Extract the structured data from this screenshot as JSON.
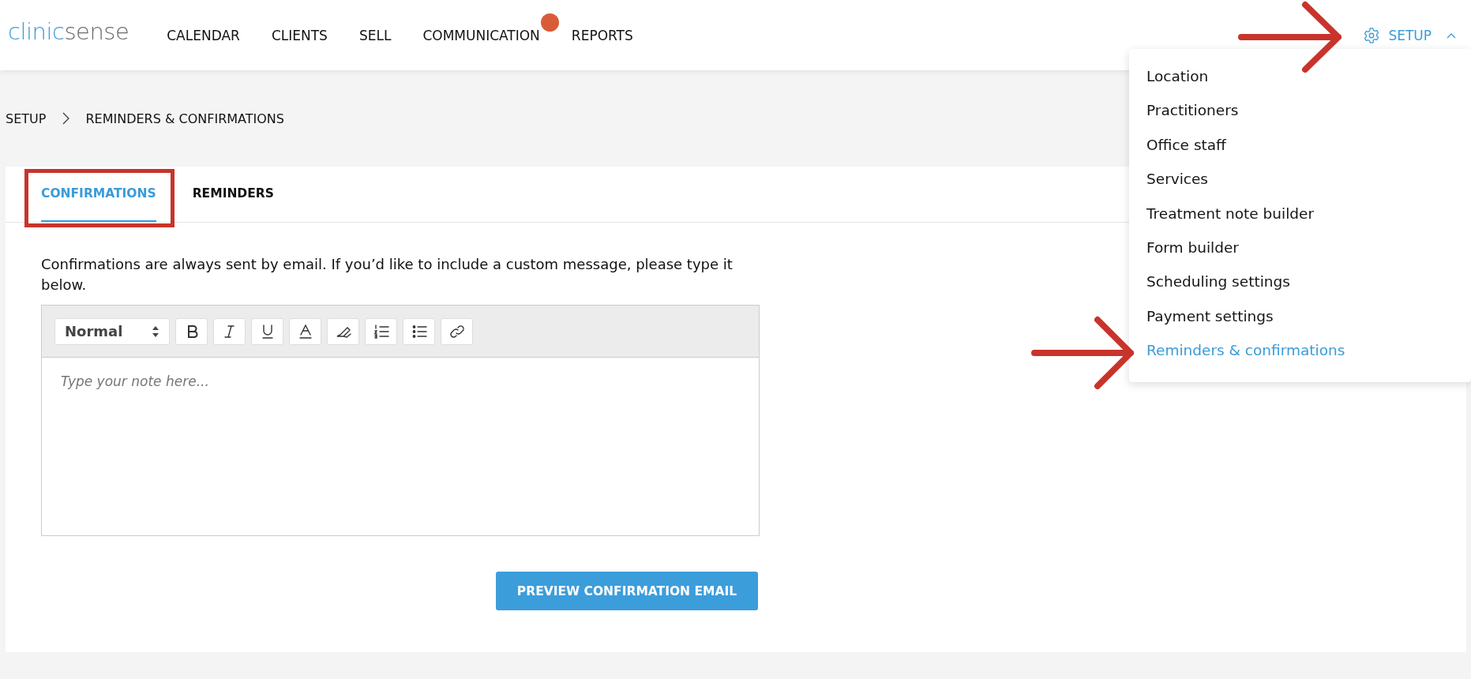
{
  "logo": {
    "primary": "clinic",
    "secondary": "sense"
  },
  "nav": [
    {
      "label": "CALENDAR",
      "badge": false
    },
    {
      "label": "CLIENTS",
      "badge": false
    },
    {
      "label": "SELL",
      "badge": false
    },
    {
      "label": "COMMUNICATION",
      "badge": true
    },
    {
      "label": "REPORTS",
      "badge": false
    }
  ],
  "setup_menu": {
    "label": "SETUP",
    "expanded": true,
    "items": [
      {
        "label": "Location",
        "selected": false
      },
      {
        "label": "Practitioners",
        "selected": false
      },
      {
        "label": "Office staff",
        "selected": false
      },
      {
        "label": "Services",
        "selected": false
      },
      {
        "label": "Treatment note builder",
        "selected": false
      },
      {
        "label": "Form builder",
        "selected": false
      },
      {
        "label": "Scheduling settings",
        "selected": false
      },
      {
        "label": "Payment settings",
        "selected": false
      },
      {
        "label": "Reminders & confirmations",
        "selected": true
      }
    ]
  },
  "breadcrumb": [
    "SETUP",
    "REMINDERS & CONFIRMATIONS"
  ],
  "tabs": [
    {
      "label": "CONFIRMATIONS",
      "selected": true
    },
    {
      "label": "REMINDERS",
      "selected": false
    }
  ],
  "intro": "Confirmations are always sent by email. If you’d like to include a custom message, please type it below.",
  "editor": {
    "format": "Normal",
    "placeholder": "Type your note here..."
  },
  "preview_button": "PREVIEW CONFIRMATION EMAIL"
}
